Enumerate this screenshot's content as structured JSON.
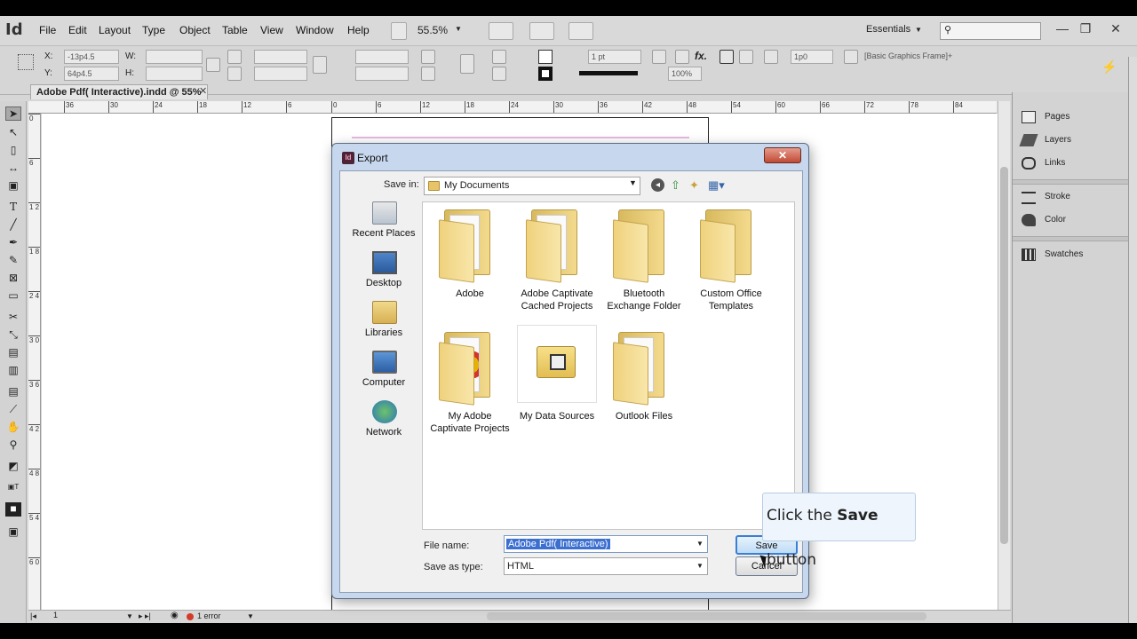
{
  "app": {
    "logo": "Id",
    "menu": [
      "File",
      "Edit",
      "Layout",
      "Type",
      "Object",
      "Table",
      "View",
      "Window",
      "Help"
    ],
    "zoom": "55.5%",
    "workspace": "Essentials",
    "minimize": "—",
    "restore": "❐",
    "close": "✕"
  },
  "control": {
    "x_label": "X:",
    "x_value": "-13p4.5",
    "y_label": "Y:",
    "y_value": "64p4.5",
    "w_label": "W:",
    "h_label": "H:",
    "stroke_weight": "1 pt",
    "scale": "100%",
    "offset": "1p0",
    "object_style": "[Basic Graphics Frame]+"
  },
  "document": {
    "tab_title": "Adobe Pdf( Interactive).indd @ 55%",
    "tab_close": "✕",
    "ruler_h": [
      "36",
      "30",
      "24",
      "18",
      "12",
      "6",
      "0",
      "6",
      "12",
      "18",
      "24",
      "30",
      "36",
      "42",
      "48",
      "54",
      "60",
      "66",
      "72",
      "78",
      "84"
    ],
    "ruler_v": [
      "0",
      "6",
      "1 2",
      "1 8",
      "2 4",
      "3 0",
      "3 6",
      "4 2",
      "4 8",
      "5 4",
      "6 0"
    ],
    "page_number": "1",
    "errors": "1 error"
  },
  "panels": {
    "items": [
      {
        "label": "Pages",
        "icon": "pages-icon"
      },
      {
        "label": "Layers",
        "icon": "layers-icon"
      },
      {
        "label": "Links",
        "icon": "links-icon"
      },
      {
        "label": "Stroke",
        "icon": "stroke-icon"
      },
      {
        "label": "Color",
        "icon": "color-icon"
      },
      {
        "label": "Swatches",
        "icon": "swatches-icon"
      }
    ]
  },
  "dialog": {
    "title": "Export",
    "save_in_label": "Save in:",
    "save_in_value": "My Documents",
    "places": [
      "Recent Places",
      "Desktop",
      "Libraries",
      "Computer",
      "Network"
    ],
    "files": [
      {
        "name": "Adobe",
        "kind": "folder"
      },
      {
        "name": "Adobe Captivate Cached Projects",
        "kind": "folder"
      },
      {
        "name": "Bluetooth Exchange Folder",
        "kind": "folder"
      },
      {
        "name": "Custom Office Templates",
        "kind": "folder"
      },
      {
        "name": "My Adobe Captivate Projects",
        "kind": "folder"
      },
      {
        "name": "My Data Sources",
        "kind": "datasource"
      },
      {
        "name": "Outlook Files",
        "kind": "folder"
      }
    ],
    "file_name_label": "File name:",
    "file_name_value": "Adobe Pdf( Interactive)",
    "save_type_label": "Save as type:",
    "save_type_value": "HTML",
    "save_button": "Save",
    "cancel_button": "Cancel",
    "close": "✕"
  },
  "tooltip": {
    "prefix": "Click the ",
    "bold": "Save",
    "suffix": " button"
  },
  "colors": {
    "dialog_frame": "#c7d8ee",
    "selection": "#3b6fd0",
    "error": "#d43a2a"
  }
}
